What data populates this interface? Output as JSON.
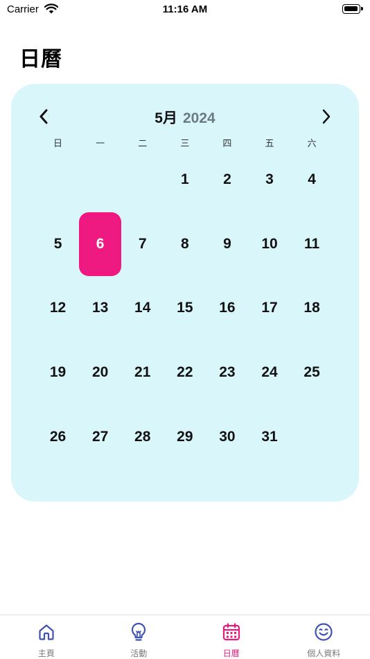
{
  "status_bar": {
    "carrier": "Carrier",
    "time": "11:16 AM"
  },
  "page": {
    "title": "日曆"
  },
  "calendar": {
    "month": "5月",
    "year": "2024",
    "weekdays": [
      "日",
      "一",
      "二",
      "三",
      "四",
      "五",
      "六"
    ],
    "weeks": [
      [
        "",
        "",
        "",
        "1",
        "2",
        "3",
        "4"
      ],
      [
        "5",
        "6",
        "7",
        "8",
        "9",
        "10",
        "11"
      ],
      [
        "12",
        "13",
        "14",
        "15",
        "16",
        "17",
        "18"
      ],
      [
        "19",
        "20",
        "21",
        "22",
        "23",
        "24",
        "25"
      ],
      [
        "26",
        "27",
        "28",
        "29",
        "30",
        "31",
        ""
      ]
    ],
    "selected_day": "6",
    "card_color": "#d9f7fb",
    "selected_color": "#ee1a82"
  },
  "tab_bar": {
    "active_color": "#e11c7e",
    "icon_color": "#3f51b5",
    "tabs": [
      {
        "label": "主頁",
        "icon": "home-icon"
      },
      {
        "label": "活動",
        "icon": "lightbulb-icon"
      },
      {
        "label": "日曆",
        "icon": "calendar-icon",
        "active": true
      },
      {
        "label": "個人資料",
        "icon": "smiley-icon"
      }
    ]
  }
}
